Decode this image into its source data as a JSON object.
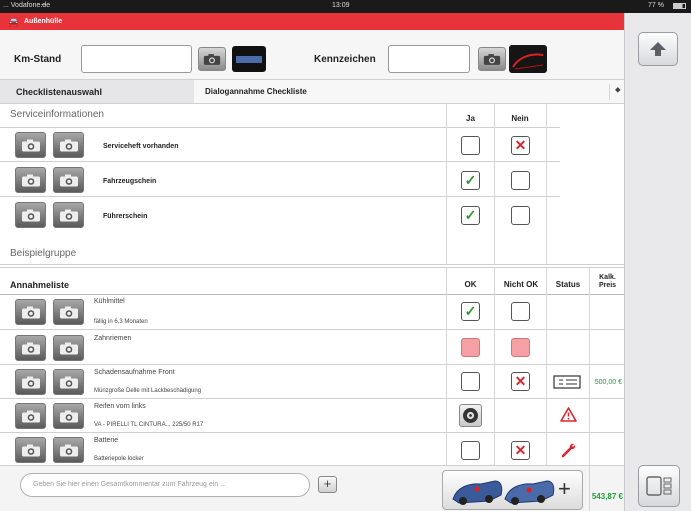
{
  "status_bar": {
    "carrier": "... Vodafone.de",
    "time": "13:09",
    "battery": "77 %"
  },
  "app_header": {
    "title": "Außenhülle"
  },
  "top_fields": {
    "km_label": "Km-Stand",
    "km_value": "",
    "plate_label": "Kennzeichen",
    "plate_value": ""
  },
  "checklist": {
    "label": "Checklistenauswahl",
    "selected": "Dialogannahme Checkliste"
  },
  "service_section": {
    "title": "Serviceinformationen",
    "col_yes": "Ja",
    "col_no": "Nein",
    "items": [
      {
        "name": "Serviceheft vorhanden",
        "ja": false,
        "nein": true
      },
      {
        "name": "Fahrzeugschein",
        "ja": true,
        "nein": false
      },
      {
        "name": "Führerschein",
        "ja": true,
        "nein": false
      }
    ]
  },
  "example_group": {
    "title": "Beispielgruppe"
  },
  "annahme": {
    "title": "Annahmeliste",
    "col_ok": "OK",
    "col_not_ok": "Nicht OK",
    "col_status": "Status",
    "col_price": "Kalk. Preis",
    "rows": [
      {
        "name": "Kühlmittel",
        "sub": "fällig in 6,3 Monaten",
        "ok": "check",
        "notok": "empty",
        "status": "",
        "price": ""
      },
      {
        "name": "Zahnriemen",
        "sub": "",
        "ok": "pink",
        "notok": "pink",
        "status": "",
        "price": ""
      },
      {
        "name": "Schadensaufnahme Front",
        "sub": "Münzgroße Delle mit Lackbeschädigung",
        "ok": "empty",
        "notok": "cross",
        "status": "list-icon",
        "price": "500,00 €"
      },
      {
        "name": "Reifen vorn links",
        "sub": "VA - PIRELLI TL CINTURA... 225/50 R17",
        "ok": "tire-icon",
        "notok": "none",
        "status": "warning-icon",
        "price": ""
      },
      {
        "name": "Batterie",
        "sub": "Batteriepole locker",
        "ok": "empty",
        "notok": "cross",
        "status": "wrench-icon",
        "price": ""
      }
    ]
  },
  "footer": {
    "comment_placeholder": "Geben Sie hier einen Gesamtkommentar zum Fahrzeug ein ...",
    "total": "543,87 €"
  },
  "colors": {
    "header_red": "#e8333a",
    "price_green": "#22a03a",
    "check_green": "#2e9a2e",
    "cross_red": "#d8262e"
  }
}
